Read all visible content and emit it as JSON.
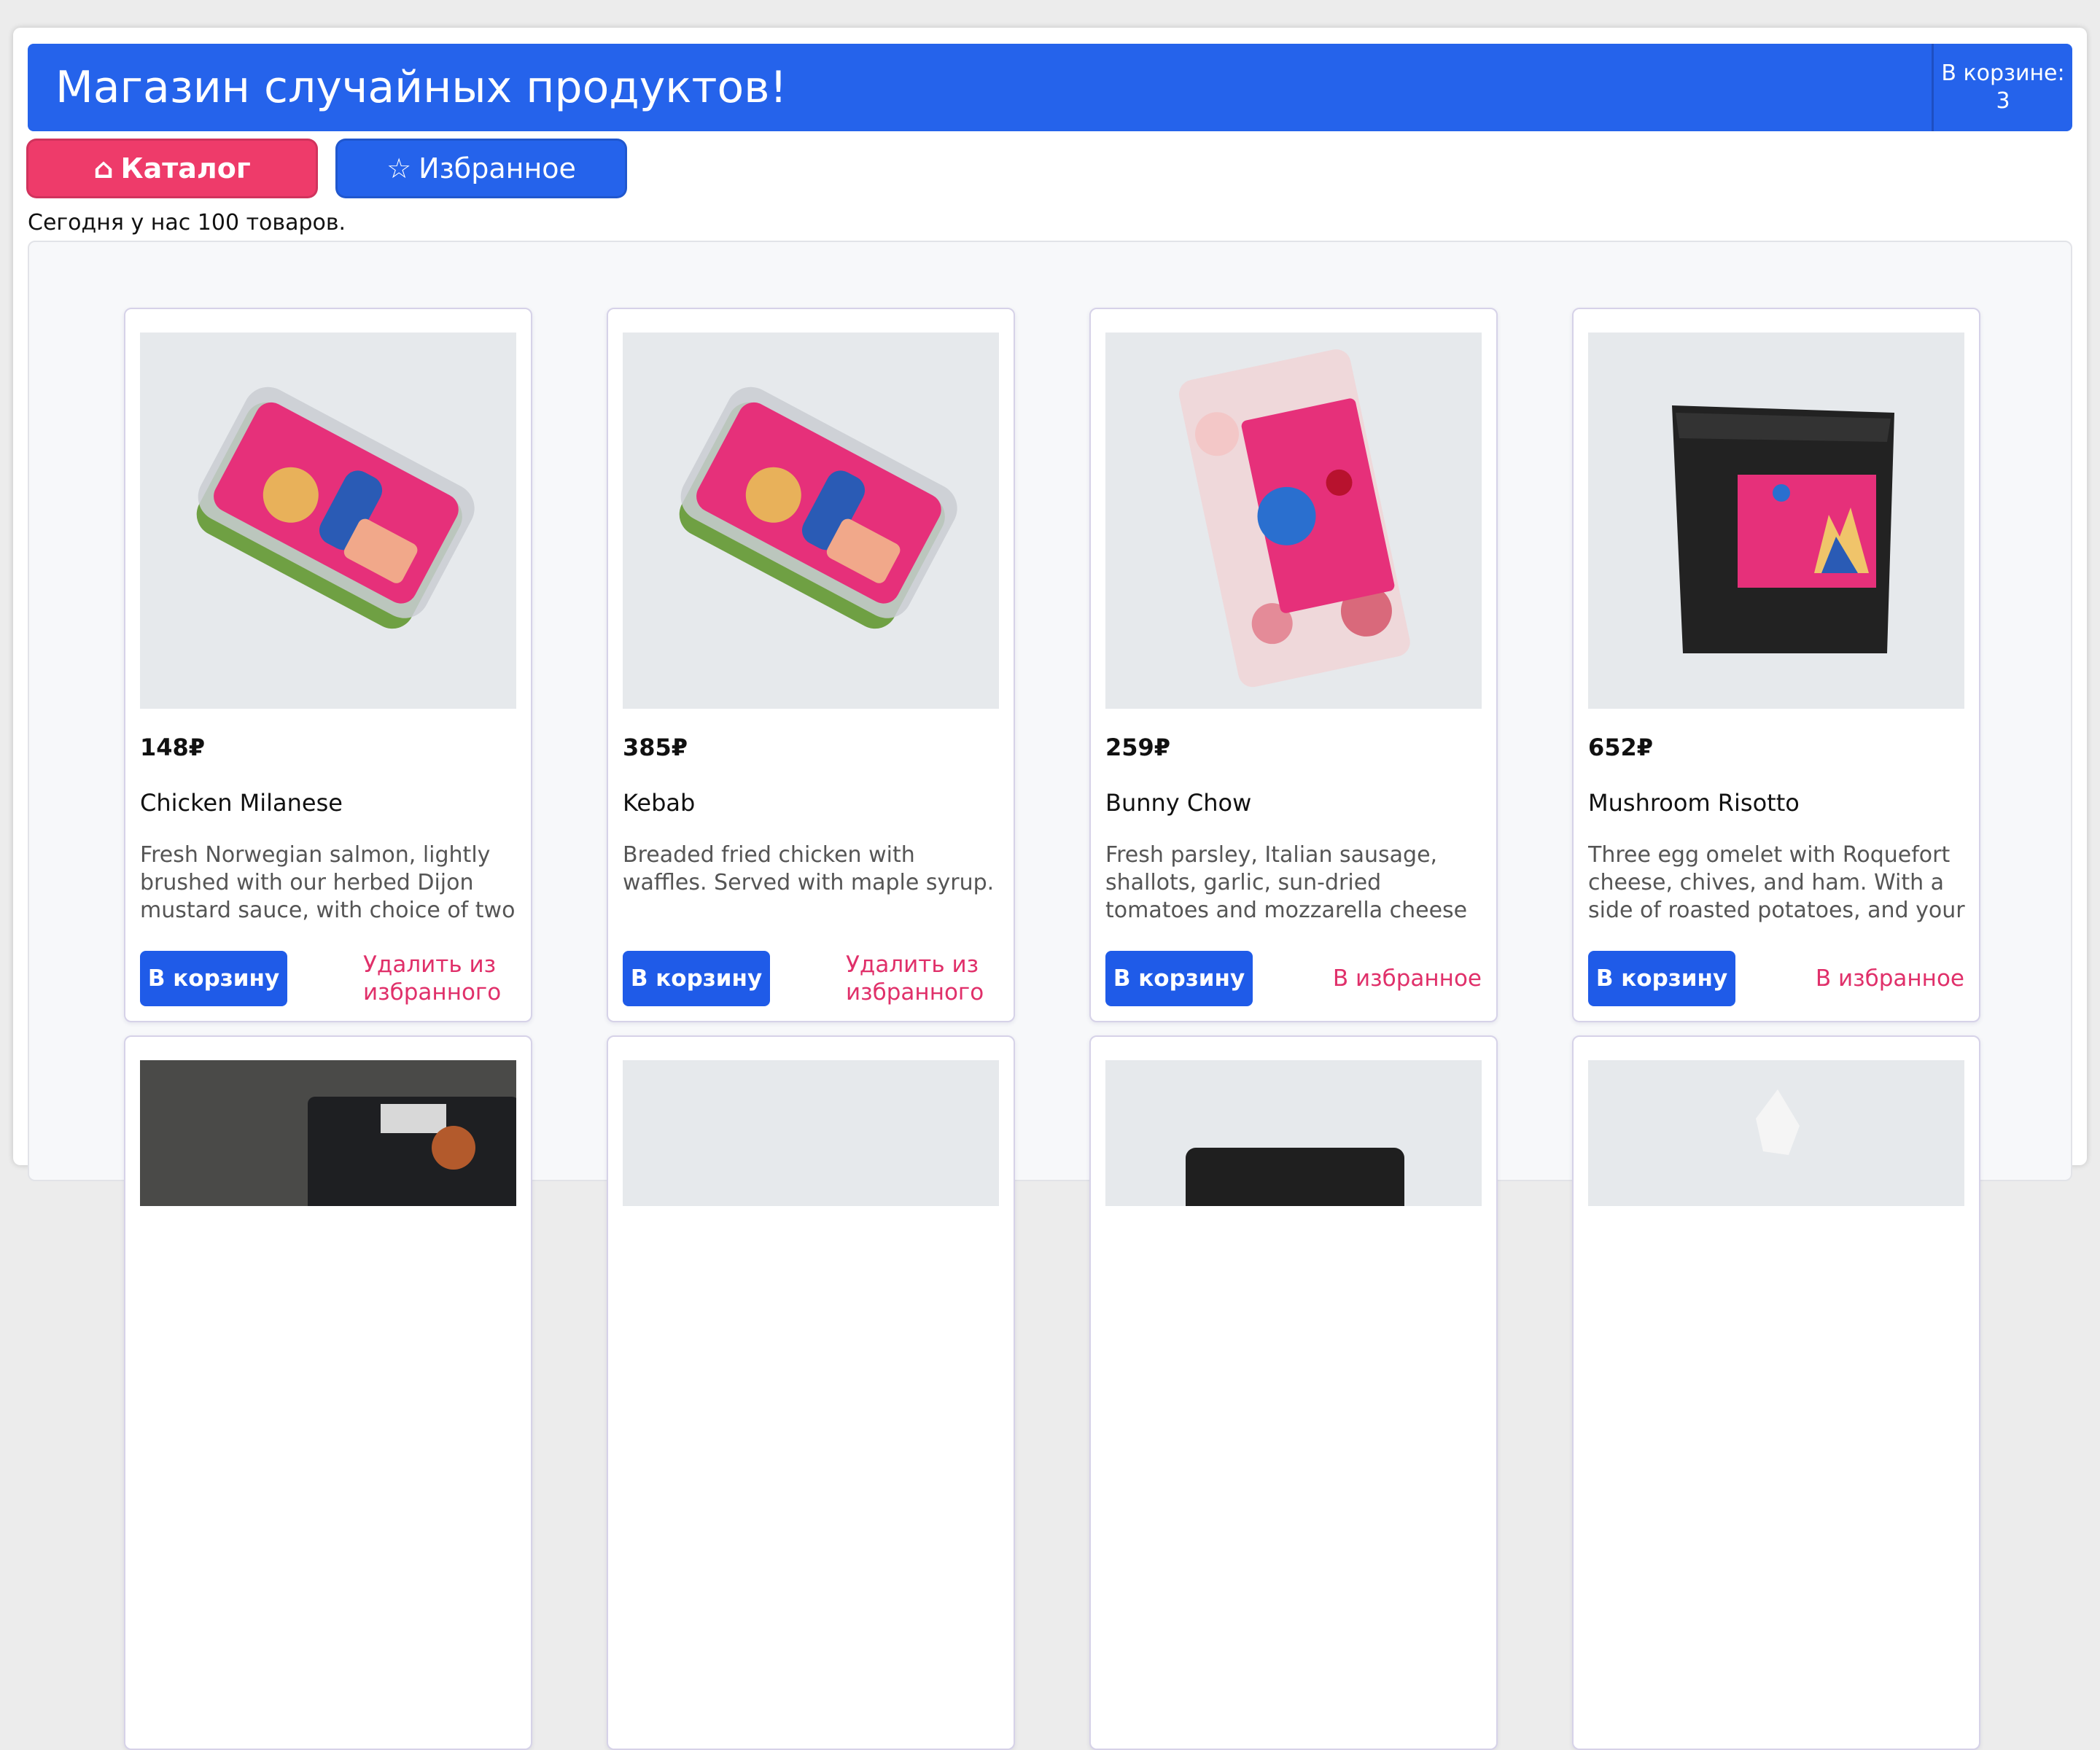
{
  "header": {
    "title": "Магазин случайных продуктов!",
    "cart_label": "В корзине:",
    "cart_count": "3"
  },
  "nav": {
    "catalog_icon": "⌂",
    "catalog_label": "Каталог",
    "favorites_icon": "☆",
    "favorites_label": "Избранное"
  },
  "catalog": {
    "count_text": "Сегодня у нас 100 товаров."
  },
  "products": [
    {
      "price": "148₽",
      "name": "Chicken Milanese",
      "description": "Fresh Norwegian salmon, lightly brushed with our herbed Dijon mustard sauce, with choice of two",
      "cart_button": "В корзину",
      "favorite_action": "Удалить из избранного",
      "image": "pashtet-tray"
    },
    {
      "price": "385₽",
      "name": "Kebab",
      "description": "Breaded fried chicken with waffles. Served with maple syrup.",
      "cart_button": "В корзину",
      "favorite_action": "Удалить из избранного",
      "image": "pashtet-tray"
    },
    {
      "price": "259₽",
      "name": "Bunny Chow",
      "description": "Fresh parsley, Italian sausage, shallots, garlic, sun-dried tomatoes and mozzarella cheese in",
      "cart_button": "В корзину",
      "favorite_action": "В избранное",
      "image": "popcorn-bag"
    },
    {
      "price": "652₽",
      "name": "Mushroom Risotto",
      "description": "Three egg omelet with Roquefort cheese, chives, and ham. With a side of roasted potatoes, and your",
      "cart_button": "В корзину",
      "favorite_action": "В избранное",
      "image": "brie-box"
    }
  ],
  "colors": {
    "header_blue": "#2563eb",
    "catalog_pink": "#ee3b6a",
    "favorite_link": "#e0306a",
    "card_border": "#d6d2e8"
  }
}
